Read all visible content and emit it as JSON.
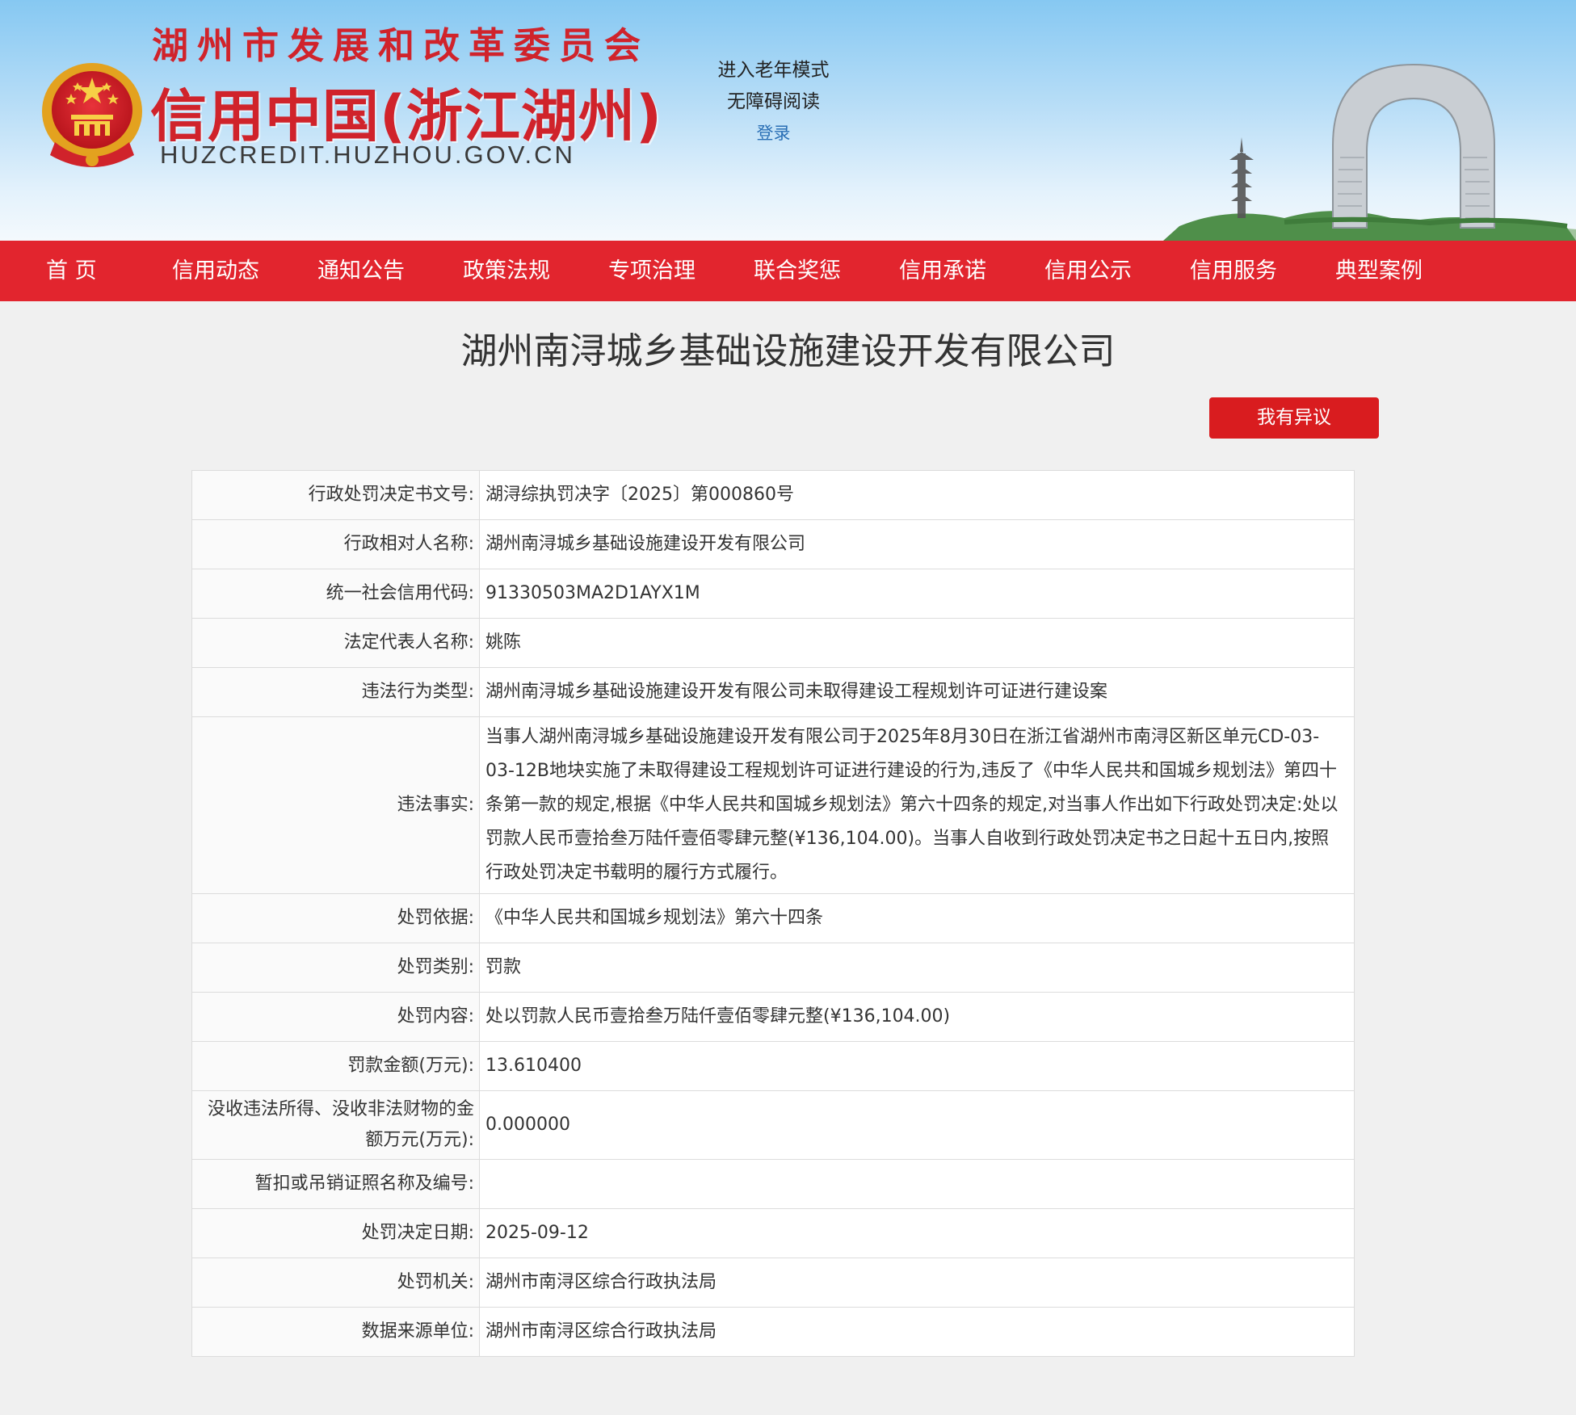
{
  "header": {
    "org_name": "湖州市发展和改革委员会",
    "site_name": "信用中国(浙江湖州)",
    "site_domain": "HUZCREDIT.HUZHOU.GOV.CN",
    "elderly_mode": "进入老年模式",
    "accessible_reading": "无障碍阅读",
    "login": "登录"
  },
  "nav": {
    "items": [
      {
        "label": "首 页"
      },
      {
        "label": "信用动态"
      },
      {
        "label": "通知公告"
      },
      {
        "label": "政策法规"
      },
      {
        "label": "专项治理"
      },
      {
        "label": "联合奖惩"
      },
      {
        "label": "信用承诺"
      },
      {
        "label": "信用公示"
      },
      {
        "label": "信用服务"
      },
      {
        "label": "典型案例"
      }
    ]
  },
  "page": {
    "title": "湖州南浔城乡基础设施建设开发有限公司",
    "objection_button": "我有异议"
  },
  "details": {
    "rows": [
      {
        "label": "行政处罚决定书文号:",
        "value": "湖浔综执罚决字〔2025〕第000860号"
      },
      {
        "label": "行政相对人名称:",
        "value": "湖州南浔城乡基础设施建设开发有限公司"
      },
      {
        "label": "统一社会信用代码:",
        "value": "91330503MA2D1AYX1M"
      },
      {
        "label": "法定代表人名称:",
        "value": "姚陈"
      },
      {
        "label": "违法行为类型:",
        "value": "湖州南浔城乡基础设施建设开发有限公司未取得建设工程规划许可证进行建设案"
      },
      {
        "label": "违法事实:",
        "value": "当事人湖州南浔城乡基础设施建设开发有限公司于2025年8月30日在浙江省湖州市南浔区新区单元CD-03-03-12B地块实施了未取得建设工程规划许可证进行建设的行为,违反了《中华人民共和国城乡规划法》第四十条第一款的规定,根据《中华人民共和国城乡规划法》第六十四条的规定,对当事人作出如下行政处罚决定:处以罚款人民币壹拾叁万陆仟壹佰零肆元整(¥136,104.00)。当事人自收到行政处罚决定书之日起十五日内,按照行政处罚决定书载明的履行方式履行。"
      },
      {
        "label": "处罚依据:",
        "value": "《中华人民共和国城乡规划法》第六十四条"
      },
      {
        "label": "处罚类别:",
        "value": "罚款"
      },
      {
        "label": "处罚内容:",
        "value": "处以罚款人民币壹拾叁万陆仟壹佰零肆元整(¥136,104.00)"
      },
      {
        "label": "罚款金额(万元):",
        "value": "13.610400"
      },
      {
        "label": "没收违法所得、没收非法财物的金额万元(万元):",
        "value": "0.000000"
      },
      {
        "label": "暂扣或吊销证照名称及编号:",
        "value": ""
      },
      {
        "label": "处罚决定日期:",
        "value": "2025-09-12"
      },
      {
        "label": "处罚机关:",
        "value": "湖州市南浔区综合行政执法局"
      },
      {
        "label": "数据来源单位:",
        "value": "湖州市南浔区综合行政执法局"
      }
    ]
  },
  "colors": {
    "brand_red": "#e2252e",
    "button_red": "#d91c1f",
    "header_sky": "#86c8f2"
  }
}
